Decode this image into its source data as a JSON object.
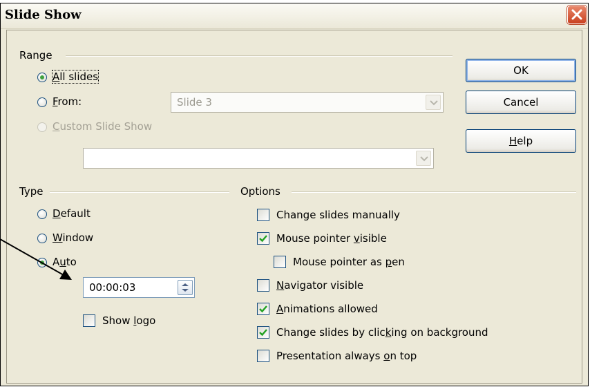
{
  "window": {
    "title": "Slide Show"
  },
  "range": {
    "label": "Range",
    "all_slides": {
      "label": "All slides",
      "mnemonic": "A",
      "selected": true
    },
    "from": {
      "label": "From:",
      "mnemonic": "F",
      "selected": false,
      "value": "Slide 3"
    },
    "custom": {
      "label": "Custom Slide Show",
      "mnemonic": "C",
      "disabled": true,
      "value": ""
    }
  },
  "buttons": {
    "ok": "OK",
    "cancel": "Cancel",
    "help": "Help"
  },
  "type": {
    "label": "Type",
    "default": {
      "label": "Default",
      "selected": false
    },
    "window": {
      "label": "Window",
      "selected": false
    },
    "auto": {
      "label": "Auto",
      "selected": true
    },
    "pause": "00:00:03",
    "show_logo": {
      "label": "Show logo",
      "checked": false
    }
  },
  "options": {
    "label": "Options",
    "items": [
      {
        "label": "Change slides manually",
        "checked": false
      },
      {
        "label": "Mouse pointer visible",
        "checked": true
      },
      {
        "label": "Mouse pointer as pen",
        "checked": false
      },
      {
        "label": "Navigator visible",
        "checked": false
      },
      {
        "label": "Animations allowed",
        "checked": true
      },
      {
        "label": "Change slides by clicking on background",
        "checked": true
      },
      {
        "label": "Presentation always on top",
        "checked": false
      }
    ]
  },
  "colors": {
    "accent": "#3fa13f",
    "button_border": "#003c74",
    "close": "#c9401f"
  },
  "icons": [
    "close-icon",
    "chevron-down-icon",
    "spin-up-icon",
    "spin-down-icon",
    "check-icon",
    "callout-arrow-icon"
  ]
}
